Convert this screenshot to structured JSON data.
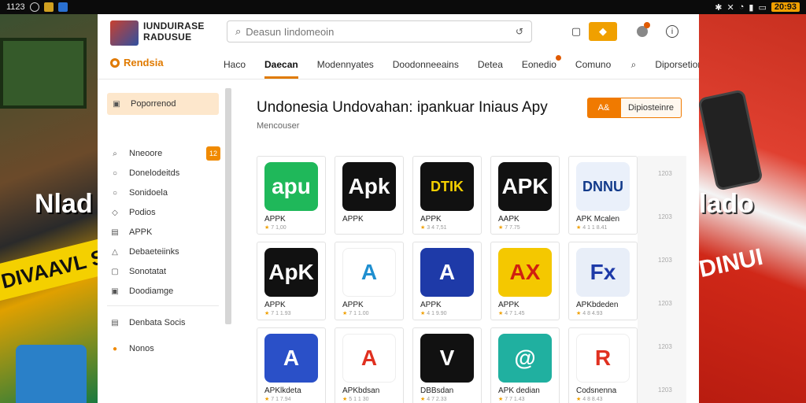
{
  "statusbar": {
    "time_left": "1123",
    "time_right": "20:93"
  },
  "colors": {
    "accent": "#f07a00",
    "accent_light": "#fde7cc",
    "badge": "#e05a00"
  },
  "header": {
    "site_title_line1": "IUNDUIRASE",
    "site_title_line2": "RADUSUE",
    "search_placeholder": "Deasun Iindomeoin",
    "brand": "Rendsia"
  },
  "nav": {
    "items": [
      {
        "label": "Haco",
        "active": false
      },
      {
        "label": "Daecan",
        "active": true
      },
      {
        "label": "Modennyates",
        "active": false
      },
      {
        "label": "Doodonneeains",
        "active": false
      },
      {
        "label": "Detea",
        "active": false
      },
      {
        "label": "Eonedio",
        "active": false,
        "badge": true
      },
      {
        "label": "Comuno",
        "active": false
      },
      {
        "label": "Diporsetion",
        "active": false
      }
    ]
  },
  "sidebar": {
    "primary": "Poporrenod",
    "items": [
      {
        "label": "Nneoore",
        "count": "12"
      },
      {
        "label": "Donelodeitds"
      },
      {
        "label": "Sonidoela"
      },
      {
        "label": "Podios"
      },
      {
        "label": "APPK"
      },
      {
        "label": "Debaeteiinks"
      },
      {
        "label": "Sonotatat"
      },
      {
        "label": "Doodiamge"
      }
    ],
    "secondary": [
      {
        "label": "Denbata Socis"
      },
      {
        "label": "Nonos"
      }
    ]
  },
  "content": {
    "title": "Undonesia Undovahan: ipankuar Iniaus Apy",
    "subtitle": "Mencouser",
    "button_primary": "A&",
    "button_secondary": "Dipiosteinre",
    "col_numbers": [
      "1203",
      "1203",
      "1203",
      "1203",
      "1203",
      "1203"
    ],
    "apps": [
      {
        "name": "APPK",
        "meta": "7 1,00",
        "icon_text": "apu",
        "bg": "#1fb85a",
        "fg": "#ffffff"
      },
      {
        "name": "APPK",
        "meta": "",
        "icon_text": "Apk",
        "bg": "#111111",
        "fg": "#ffffff"
      },
      {
        "name": "APPK",
        "meta": "3 4 7,51",
        "icon_text": "DTIK",
        "bg": "#111111",
        "fg": "#f4d000"
      },
      {
        "name": "AAPK",
        "meta": "7 7.75",
        "icon_text": "APK",
        "bg": "#111111",
        "fg": "#ffffff"
      },
      {
        "name": "APK Mcalen",
        "meta": "4 1 1 8.41",
        "icon_text": "DNNU",
        "bg": "#eaf0fa",
        "fg": "#123a8a"
      },
      {
        "name": "APPK",
        "meta": "7 1 1.93",
        "icon_text": "ApK",
        "bg": "#111111",
        "fg": "#ffffff"
      },
      {
        "name": "APPK",
        "meta": "7 1 1.00",
        "icon_text": "A",
        "bg": "#ffffff",
        "fg": "#1f8fd0"
      },
      {
        "name": "APPK",
        "meta": "4 1 9.90",
        "icon_text": "A",
        "bg": "#1e3aa8",
        "fg": "#ffffff"
      },
      {
        "name": "APPK",
        "meta": "4 7 1.45",
        "icon_text": "AX",
        "bg": "#f4c800",
        "fg": "#d02010"
      },
      {
        "name": "APKbdeden",
        "meta": "4 8 4.93",
        "icon_text": "Fx",
        "bg": "#e8eef8",
        "fg": "#1e3aa8"
      },
      {
        "name": "APKlkdeta",
        "meta": "7 1 7.94",
        "icon_text": "A",
        "bg": "#2a50c8",
        "fg": "#ffffff"
      },
      {
        "name": "APKbdsan",
        "meta": "5 1 1 30",
        "icon_text": "A",
        "bg": "#ffffff",
        "fg": "#e03020"
      },
      {
        "name": "DBBsdan",
        "meta": "4 7 2.33",
        "icon_text": "V",
        "bg": "#111111",
        "fg": "#ffffff"
      },
      {
        "name": "APK dedian",
        "meta": "7 7 1.43",
        "icon_text": "@",
        "bg": "#20b0a0",
        "fg": "#ffffff"
      },
      {
        "name": "Codsnenna",
        "meta": "4 8 8.43",
        "icon_text": "R",
        "bg": "#ffffff",
        "fg": "#e03020"
      }
    ]
  },
  "background": {
    "left_text": "Nlad",
    "left_band": "DIVAAVL S",
    "right_text": "lado",
    "right_band": "DINUI"
  }
}
